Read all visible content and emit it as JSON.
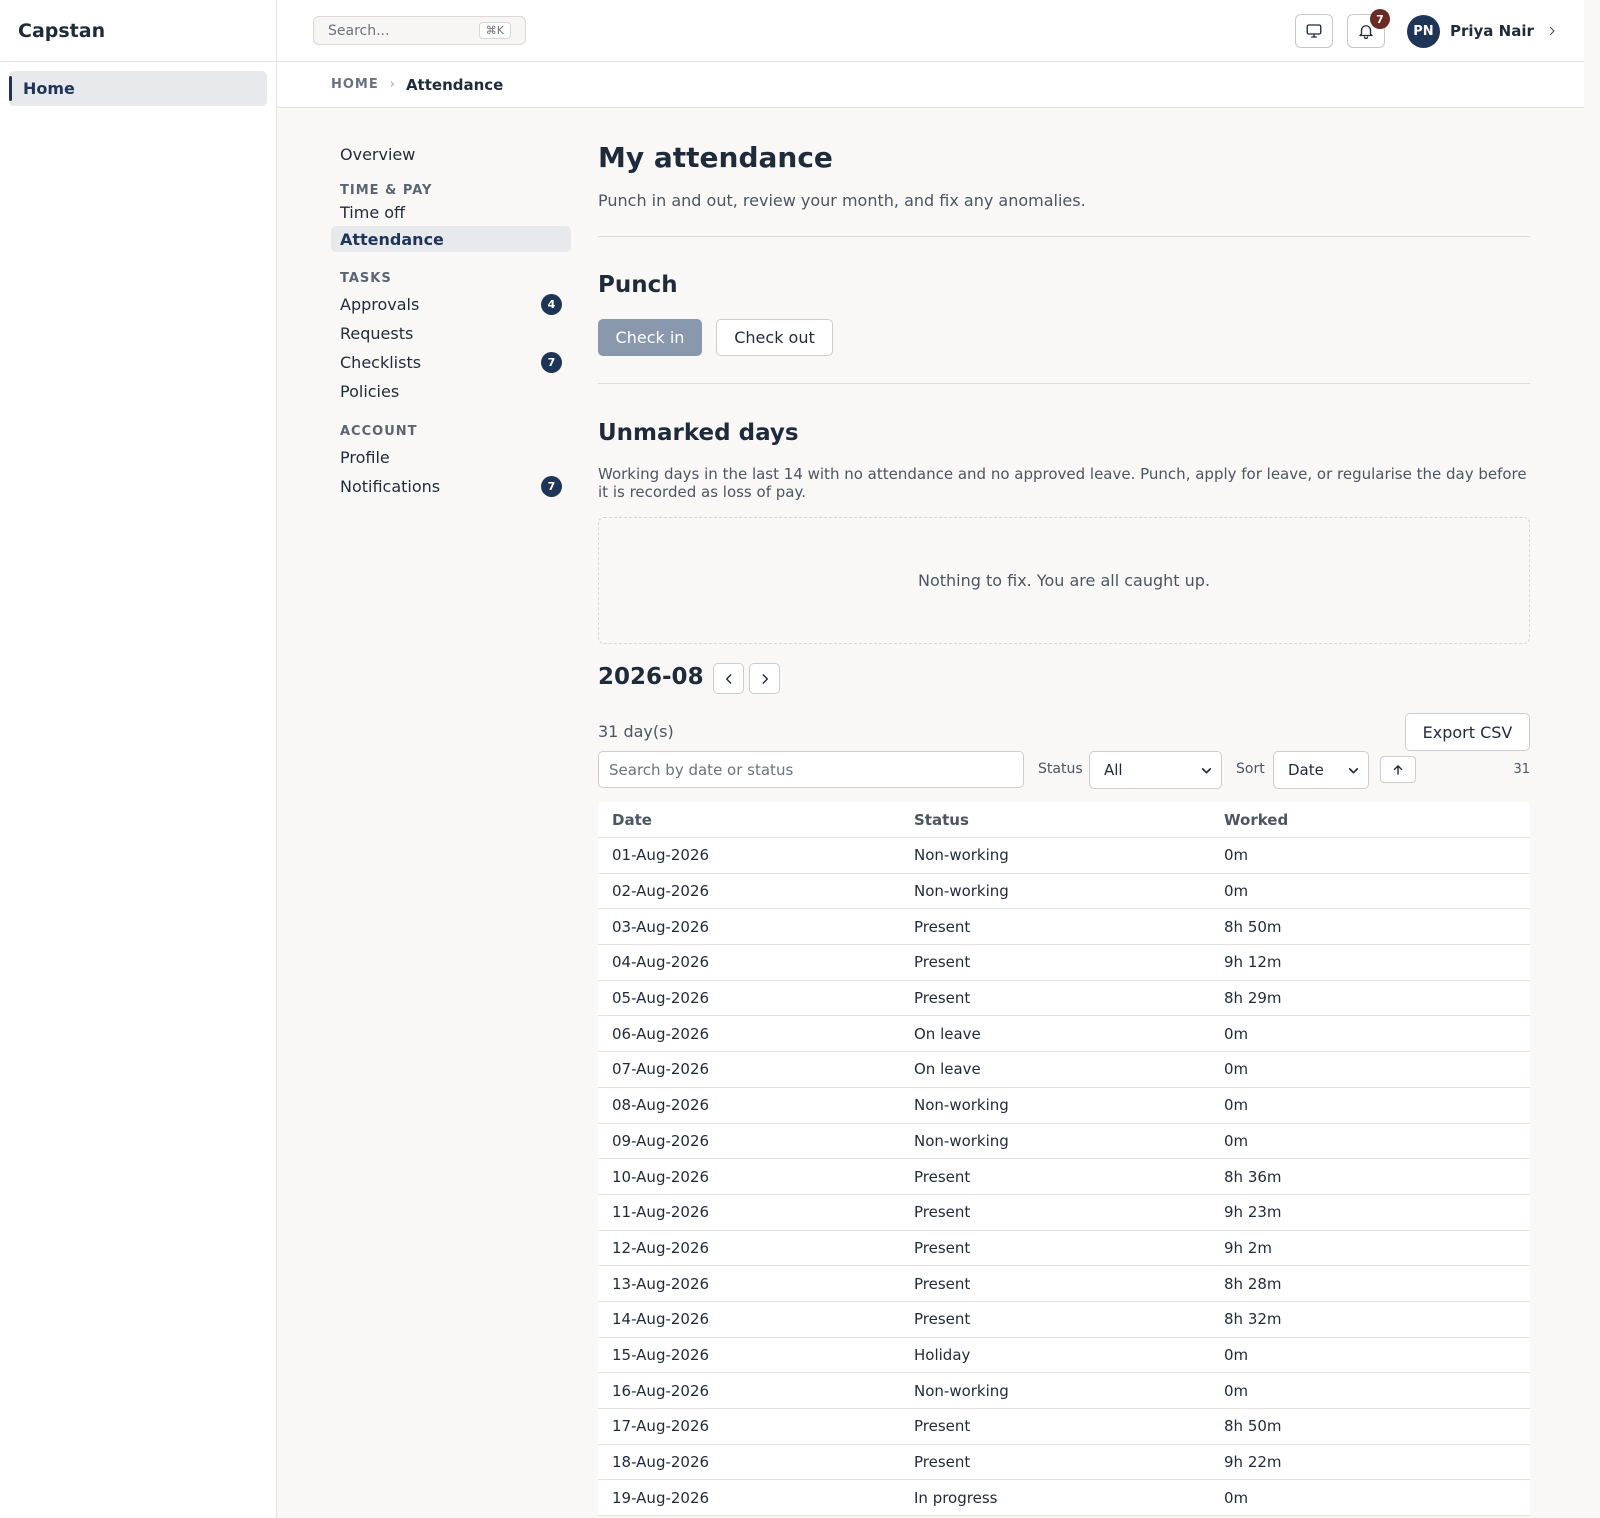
{
  "app": {
    "brand": "Capstan",
    "nav_home": "Home"
  },
  "topbar": {
    "search_placeholder": "Search...",
    "search_shortcut": "⌘K",
    "notification_count": "7",
    "user_initials": "PN",
    "user_name": "Priya Nair"
  },
  "breadcrumb": {
    "home": "HOME",
    "current": "Attendance"
  },
  "subnav": {
    "overview": "Overview",
    "group_time_pay": "TIME & PAY",
    "time_off": "Time off",
    "attendance": "Attendance",
    "group_tasks": "TASKS",
    "approvals": "Approvals",
    "approvals_count": "4",
    "requests": "Requests",
    "checklists": "Checklists",
    "checklists_count": "7",
    "policies": "Policies",
    "group_account": "ACCOUNT",
    "profile": "Profile",
    "notifications": "Notifications",
    "notifications_count": "7"
  },
  "page": {
    "title": "My attendance",
    "subtitle": "Punch in and out, review your month, and fix any anomalies."
  },
  "punch": {
    "title": "Punch",
    "check_in": "Check in",
    "check_out": "Check out"
  },
  "unmarked": {
    "title": "Unmarked days",
    "description": "Working days in the last 14 with no attendance and no approved leave. Punch, apply for leave, or regularise the day before it is recorded as loss of pay.",
    "empty": "Nothing to fix. You are all caught up."
  },
  "month": {
    "label": "2026-08",
    "day_count": "31 day(s)",
    "export": "Export CSV",
    "search_placeholder": "Search by date or status",
    "status_label": "Status",
    "status_value": "All",
    "sort_label": "Sort",
    "sort_value": "Date",
    "row_count": "31"
  },
  "table": {
    "headers": [
      "Date",
      "Status",
      "Worked"
    ],
    "rows": [
      [
        "01-Aug-2026",
        "Non-working",
        "0m"
      ],
      [
        "02-Aug-2026",
        "Non-working",
        "0m"
      ],
      [
        "03-Aug-2026",
        "Present",
        "8h 50m"
      ],
      [
        "04-Aug-2026",
        "Present",
        "9h 12m"
      ],
      [
        "05-Aug-2026",
        "Present",
        "8h 29m"
      ],
      [
        "06-Aug-2026",
        "On leave",
        "0m"
      ],
      [
        "07-Aug-2026",
        "On leave",
        "0m"
      ],
      [
        "08-Aug-2026",
        "Non-working",
        "0m"
      ],
      [
        "09-Aug-2026",
        "Non-working",
        "0m"
      ],
      [
        "10-Aug-2026",
        "Present",
        "8h 36m"
      ],
      [
        "11-Aug-2026",
        "Present",
        "9h 23m"
      ],
      [
        "12-Aug-2026",
        "Present",
        "9h 2m"
      ],
      [
        "13-Aug-2026",
        "Present",
        "8h 28m"
      ],
      [
        "14-Aug-2026",
        "Present",
        "8h 32m"
      ],
      [
        "15-Aug-2026",
        "Holiday",
        "0m"
      ],
      [
        "16-Aug-2026",
        "Non-working",
        "0m"
      ],
      [
        "17-Aug-2026",
        "Present",
        "8h 50m"
      ],
      [
        "18-Aug-2026",
        "Present",
        "9h 22m"
      ],
      [
        "19-Aug-2026",
        "In progress",
        "0m"
      ]
    ]
  }
}
